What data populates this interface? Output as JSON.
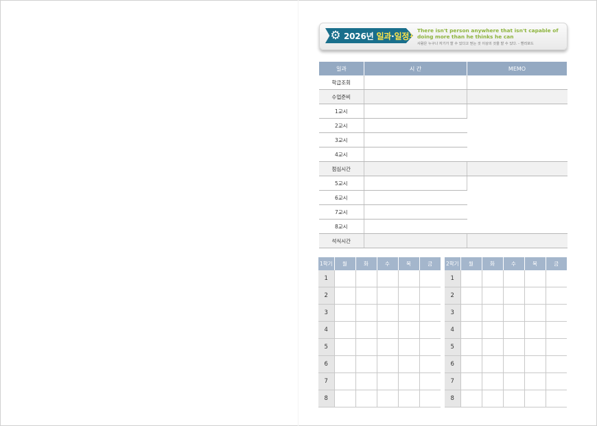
{
  "banner": {
    "year": "2026년",
    "title_part1": "일과",
    "title_part2": "일정표",
    "icon": "gear-icon",
    "quote_en": "There isn't person anywhere that isn't capable of doing more than he thinks he can",
    "quote_ko": "사람은 누구나 자기가 할 수 있다고 믿는 것 이상의 것을 할 수 있다. - 헨리포드",
    "colors": {
      "badge": "#196f8c",
      "quote": "#8cb33b",
      "header": "#94a9c2"
    }
  },
  "schedule": {
    "headers": [
      "일과",
      "시 간",
      "MEMO"
    ],
    "rows": [
      "학급조회",
      "수업준비",
      "1교시",
      "2교시",
      "3교시",
      "4교시",
      "점심시간",
      "5교시",
      "6교시",
      "7교시",
      "8교시",
      "석식시간"
    ]
  },
  "grid1": {
    "headers": [
      "1학기",
      "월",
      "화",
      "수",
      "목",
      "금"
    ],
    "rows": [
      "1",
      "2",
      "3",
      "4",
      "5",
      "6",
      "7",
      "8"
    ]
  },
  "grid2": {
    "headers": [
      "2학기",
      "월",
      "화",
      "수",
      "목",
      "금"
    ],
    "rows": [
      "1",
      "2",
      "3",
      "4",
      "5",
      "6",
      "7",
      "8"
    ]
  }
}
